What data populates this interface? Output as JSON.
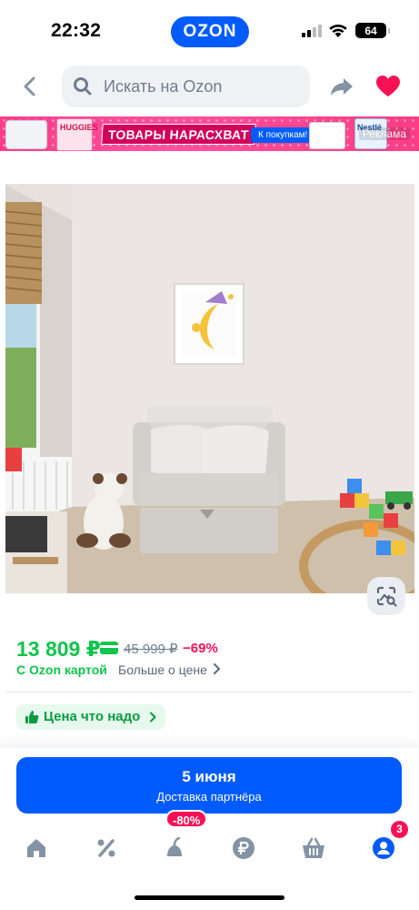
{
  "status_bar": {
    "time": "22:32",
    "battery": "64"
  },
  "header": {
    "logo": "OZON",
    "search_placeholder": "Искать на Ozon",
    "icons": [
      "chevron-left-icon",
      "search-icon",
      "share-icon",
      "heart-icon"
    ]
  },
  "banner": {
    "title": "ТОВАРЫ НАРАСХВАТ",
    "cta": "К покупкам!",
    "ad_label": "Реклама",
    "product_1_brand": "HUGGIES",
    "product_2_brand": "Nestlé"
  },
  "product": {
    "price": "13 809 ₽",
    "old_price": "45 999 ₽",
    "discount": "−69%",
    "card_label": "С Ozon картой",
    "more_price": "Больше о цене",
    "price_chip": "Цена что надо"
  },
  "delivery": {
    "date": "5 июня",
    "subtitle": "Доставка партнёра"
  },
  "tabbar": {
    "tabs": [
      "home-icon",
      "percent-icon",
      "fresh-icon",
      "ruble-icon",
      "basket-icon",
      "profile-icon"
    ],
    "promo_badge": "-80%",
    "cart_count": "3"
  },
  "colors": {
    "brand_blue": "#005bff",
    "price_green": "#10c44c",
    "discount_pink": "#f91155"
  }
}
